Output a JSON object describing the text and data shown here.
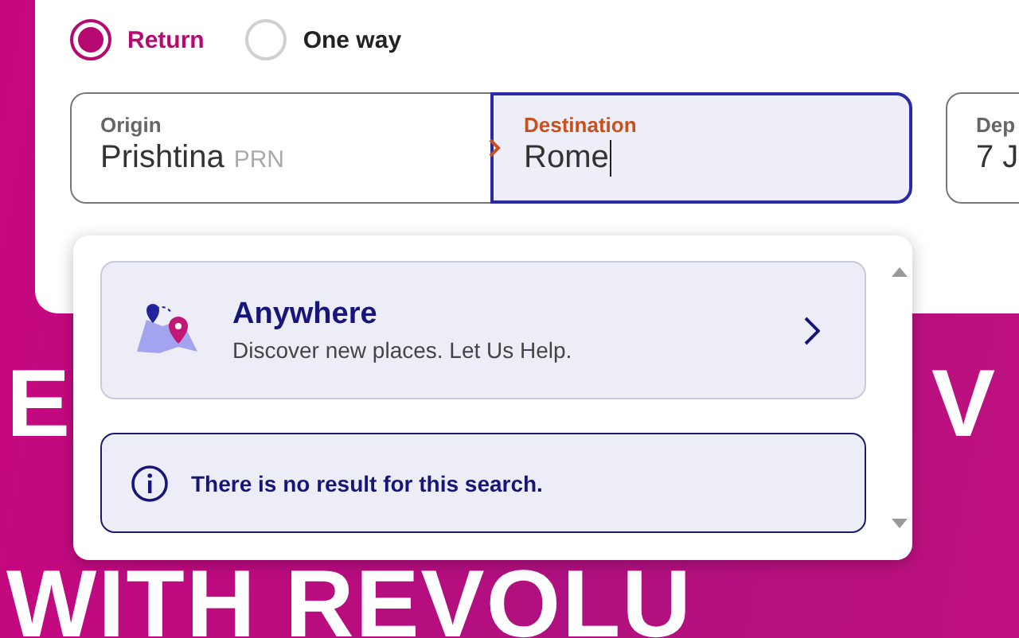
{
  "trip_type": [
    {
      "label": "Return",
      "selected": true
    },
    {
      "label": "One way",
      "selected": false
    }
  ],
  "fields": [
    {
      "label": "Origin",
      "value": "Prishtina",
      "code": "PRN",
      "focused": false
    },
    {
      "label": "Destination",
      "value": "Rome",
      "focused": true
    },
    {
      "label": "Dep",
      "value": "7 J",
      "focused": false
    }
  ],
  "dropdown": {
    "suggestion": {
      "title": "Anywhere",
      "subtitle": "Discover new places. Let Us Help."
    },
    "message": "There is no result for this search."
  },
  "headline": {
    "line_1": [
      "E",
      "V"
    ],
    "line_2": "WITH REVOLU"
  }
}
